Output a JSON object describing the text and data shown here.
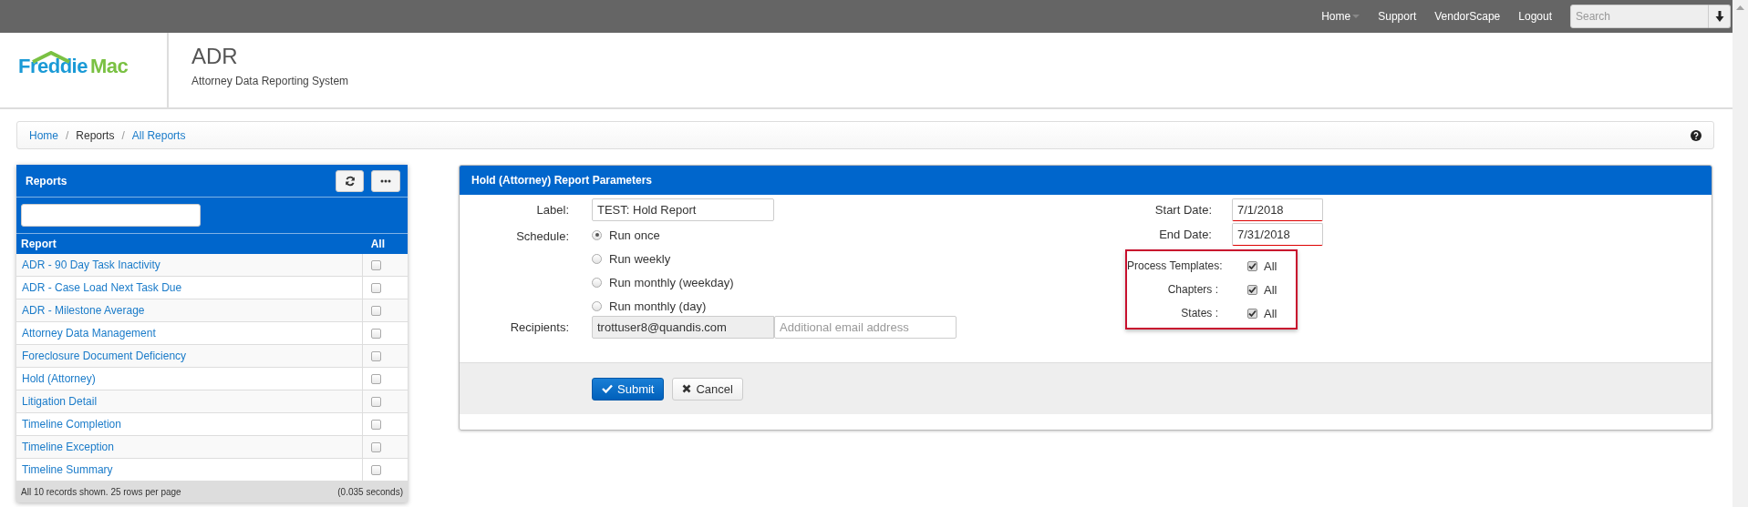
{
  "top_nav": {
    "links": [
      {
        "label": "Home",
        "dropdown": true
      },
      {
        "label": "Support",
        "dropdown": false
      },
      {
        "label": "VendorScape",
        "dropdown": false
      },
      {
        "label": "Logout",
        "dropdown": false
      }
    ],
    "search": {
      "placeholder": "Search"
    }
  },
  "header": {
    "logo": [
      "Freddie",
      "Mac"
    ],
    "title": "ADR",
    "subtitle": "Attorney Data Reporting System"
  },
  "breadcrumb": {
    "separator": "/",
    "items": [
      {
        "label": "Home",
        "link": true
      },
      {
        "label": "Reports",
        "link": false
      },
      {
        "label": "All Reports",
        "link": true
      }
    ]
  },
  "reports_panel": {
    "title": "Reports",
    "columns": [
      "Report",
      "All"
    ],
    "rows": [
      {
        "name": "ADR - 90 Day Task Inactivity",
        "checked": false
      },
      {
        "name": "ADR - Case Load Next Task Due",
        "checked": false
      },
      {
        "name": "ADR - Milestone Average",
        "checked": false
      },
      {
        "name": "Attorney Data Management",
        "checked": false
      },
      {
        "name": "Foreclosure Document Deficiency",
        "checked": false
      },
      {
        "name": "Hold (Attorney)",
        "checked": false
      },
      {
        "name": "Litigation Detail",
        "checked": false
      },
      {
        "name": "Timeline Completion",
        "checked": false
      },
      {
        "name": "Timeline Exception",
        "checked": false
      },
      {
        "name": "Timeline Summary",
        "checked": false
      }
    ],
    "footer_left": "All 10 records shown. 25 rows per page",
    "footer_right": "(0.035 seconds)"
  },
  "parameters_panel": {
    "title": "Hold (Attorney) Report Parameters",
    "label_field": {
      "label": "Label:",
      "value": "TEST: Hold Report"
    },
    "schedule": {
      "label": "Schedule:",
      "options": [
        {
          "label": "Run once",
          "selected": true
        },
        {
          "label": "Run weekly",
          "selected": false
        },
        {
          "label": "Run monthly (weekday)",
          "selected": false
        },
        {
          "label": "Run monthly (day)",
          "selected": false
        }
      ]
    },
    "recipients": {
      "label": "Recipients:",
      "value": "trottuser8@quandis.com",
      "placeholder": "Additional email address"
    },
    "dates": [
      {
        "label": "Start Date:",
        "value": "7/1/2018"
      },
      {
        "label": "End Date:",
        "value": "7/31/2018"
      }
    ],
    "filters_highlighted": true,
    "filters": [
      {
        "label": "Process Templates:",
        "checked": true,
        "text": "All"
      },
      {
        "label": "Chapters :",
        "checked": true,
        "text": "All"
      },
      {
        "label": "States :",
        "checked": true,
        "text": "All"
      }
    ],
    "buttons": [
      {
        "kind": "submit",
        "label": "Submit"
      },
      {
        "kind": "cancel",
        "label": "Cancel"
      }
    ]
  }
}
